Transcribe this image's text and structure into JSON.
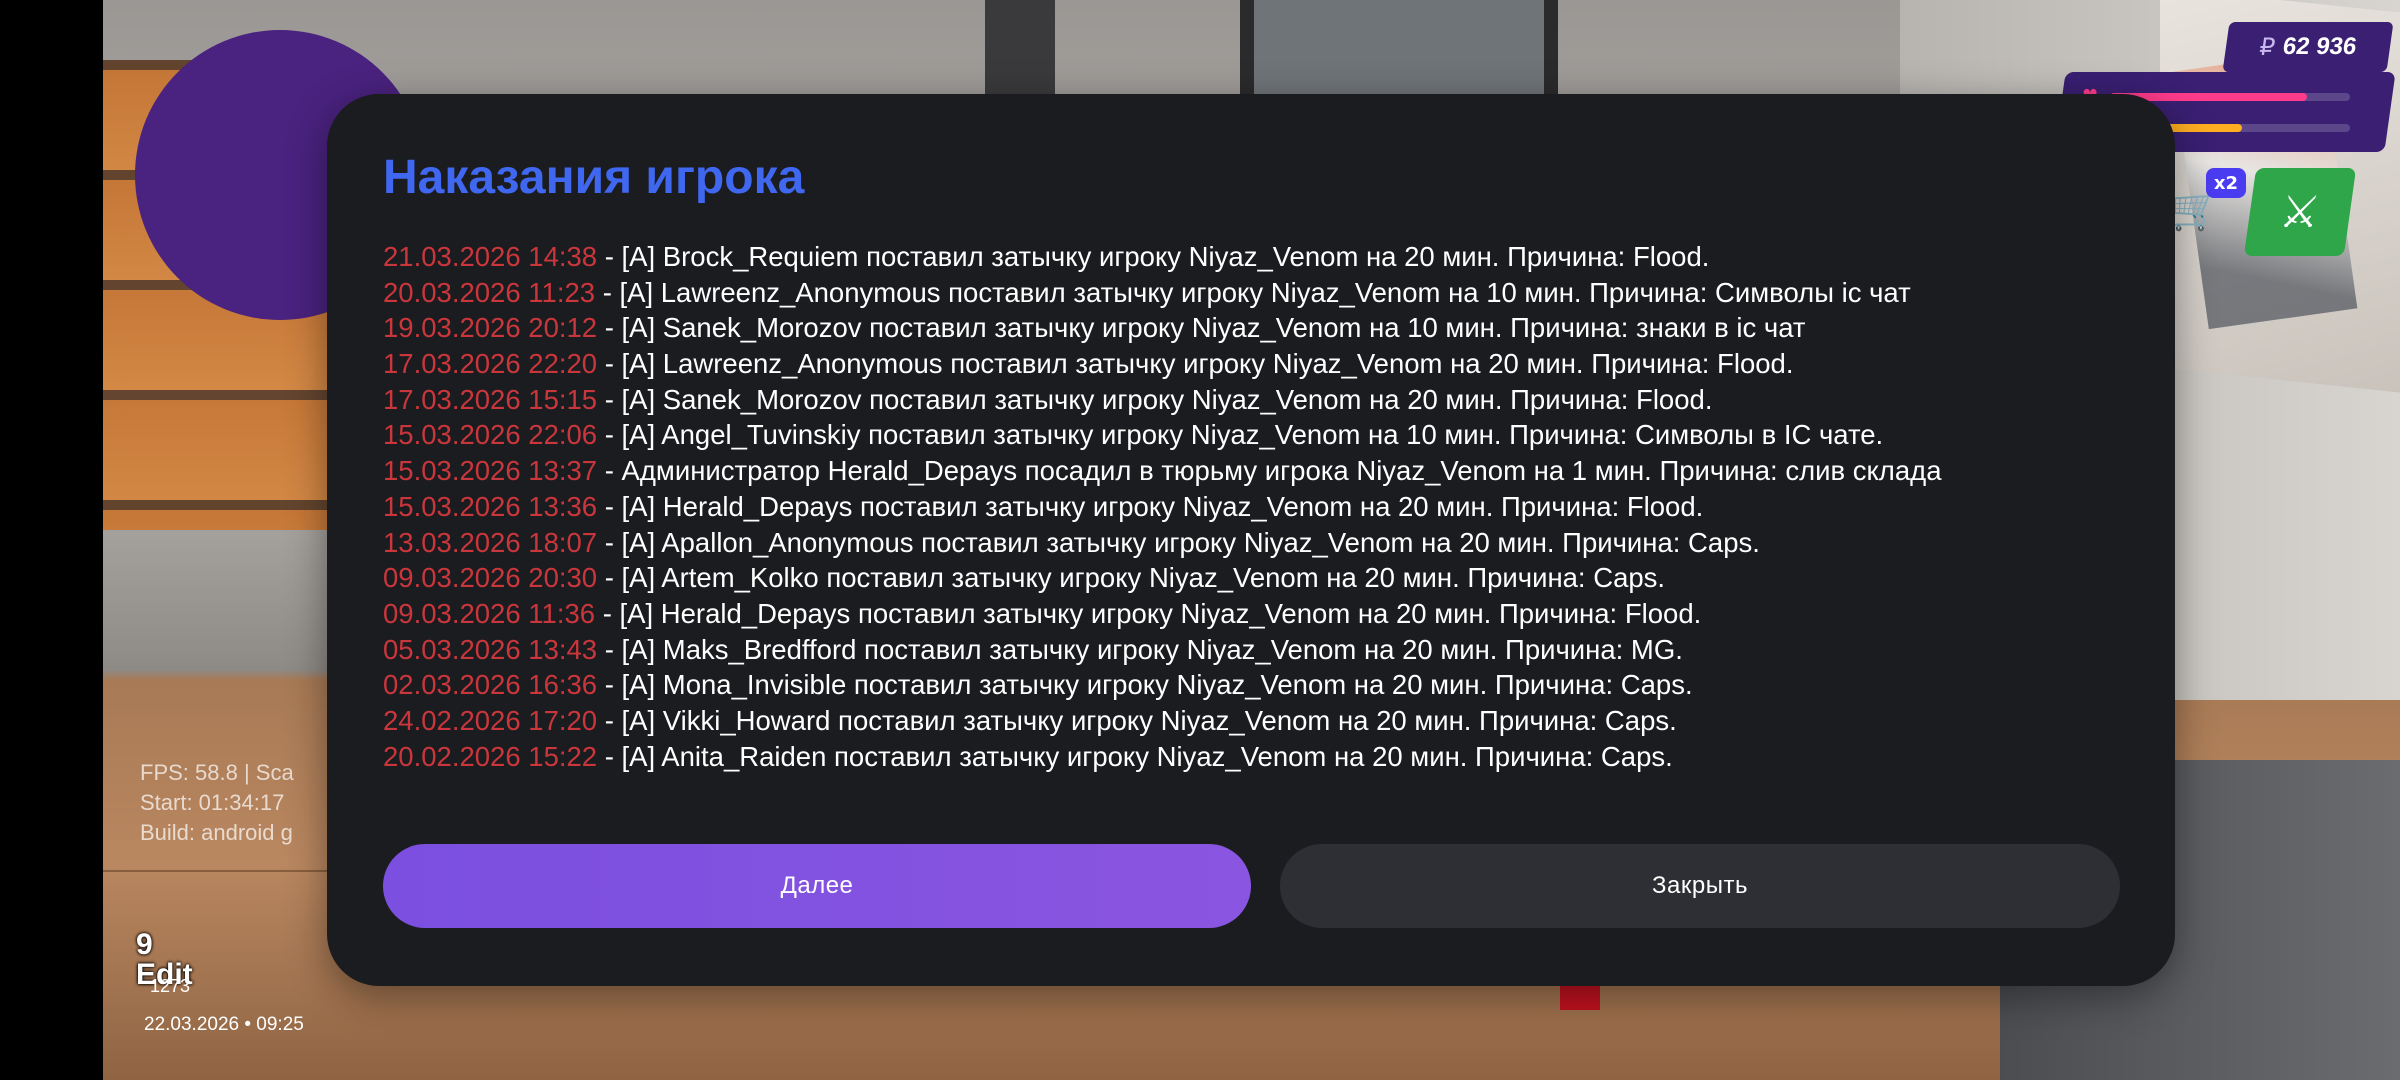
{
  "hud": {
    "money_currency": "₽",
    "money_value": "62 936",
    "x2_badge": "x2",
    "health_level": 0.82,
    "hunger_level": 0.55
  },
  "debug": {
    "fps_line": "FPS: 58.8 | Sca",
    "start_line": "Start: 01:34:17",
    "build_line": "Build: android g"
  },
  "overlay": {
    "number": "9",
    "edit": "Edit",
    "edit_sub": "1273",
    "datetime": "22.03.2026 • 09:25"
  },
  "dialog": {
    "title": "Наказания игрока",
    "entries": [
      {
        "date": "21.03.2026 14:38",
        "text": " - [A] Brock_Requiem поставил затычку игроку Niyaz_Venom на 20 мин. Причина: Flood."
      },
      {
        "date": "20.03.2026 11:23",
        "text": " - [A] Lawreenz_Anonymous поставил затычку игроку Niyaz_Venom на 10 мин. Причина: Символы ic чат"
      },
      {
        "date": "19.03.2026 20:12",
        "text": " - [A] Sanek_Morozov поставил затычку игроку Niyaz_Venom на 10 мин. Причина: знаки в ic чат"
      },
      {
        "date": "17.03.2026 22:20",
        "text": " - [A] Lawreenz_Anonymous поставил затычку игроку Niyaz_Venom на 20 мин. Причина: Flood."
      },
      {
        "date": "17.03.2026 15:15",
        "text": " - [A] Sanek_Morozov поставил затычку игроку Niyaz_Venom на 20 мин. Причина: Flood."
      },
      {
        "date": "15.03.2026 22:06",
        "text": " - [A] Angel_Tuvinskiy поставил затычку игроку Niyaz_Venom на 10 мин. Причина: Символы в IC чате."
      },
      {
        "date": "15.03.2026 13:37",
        "text": " - Администратор Herald_Depays посадил в тюрьму игрока Niyaz_Venom на 1 мин. Причина: слив склада"
      },
      {
        "date": "15.03.2026 13:36",
        "text": " - [A] Herald_Depays поставил затычку игроку Niyaz_Venom на 20 мин. Причина: Flood."
      },
      {
        "date": "13.03.2026 18:07",
        "text": " - [A] Apallon_Anonymous поставил затычку игроку Niyaz_Venom на 20 мин. Причина: Caps."
      },
      {
        "date": "09.03.2026 20:30",
        "text": " - [A] Artem_Kolko поставил затычку игроку Niyaz_Venom на 20 мин. Причина: Caps."
      },
      {
        "date": "09.03.2026 11:36",
        "text": " - [A] Herald_Depays поставил затычку игроку Niyaz_Venom на 20 мин. Причина: Flood."
      },
      {
        "date": "05.03.2026 13:43",
        "text": " - [A] Maks_Bredfford поставил затычку игроку Niyaz_Venom на 20 мин. Причина: MG."
      },
      {
        "date": "02.03.2026 16:36",
        "text": " - [A] Mona_Invisible поставил затычку игроку Niyaz_Venom на 20 мин. Причина: Caps."
      },
      {
        "date": "24.02.2026 17:20",
        "text": " - [A] Vikki_Howard поставил затычку игроку Niyaz_Venom на 20 мин. Причина: Caps."
      },
      {
        "date": "20.02.2026 15:22",
        "text": " - [A] Anita_Raiden поставил затычку игроку Niyaz_Venom на 20 мин. Причина: Caps."
      }
    ],
    "next_label": "Далее",
    "close_label": "Закрыть"
  },
  "colors": {
    "title": "#3f67f0",
    "date": "#c9363b",
    "panel": "#1b1c20",
    "next_button": "#7b4fe0",
    "close_button": "#2e2f34"
  }
}
